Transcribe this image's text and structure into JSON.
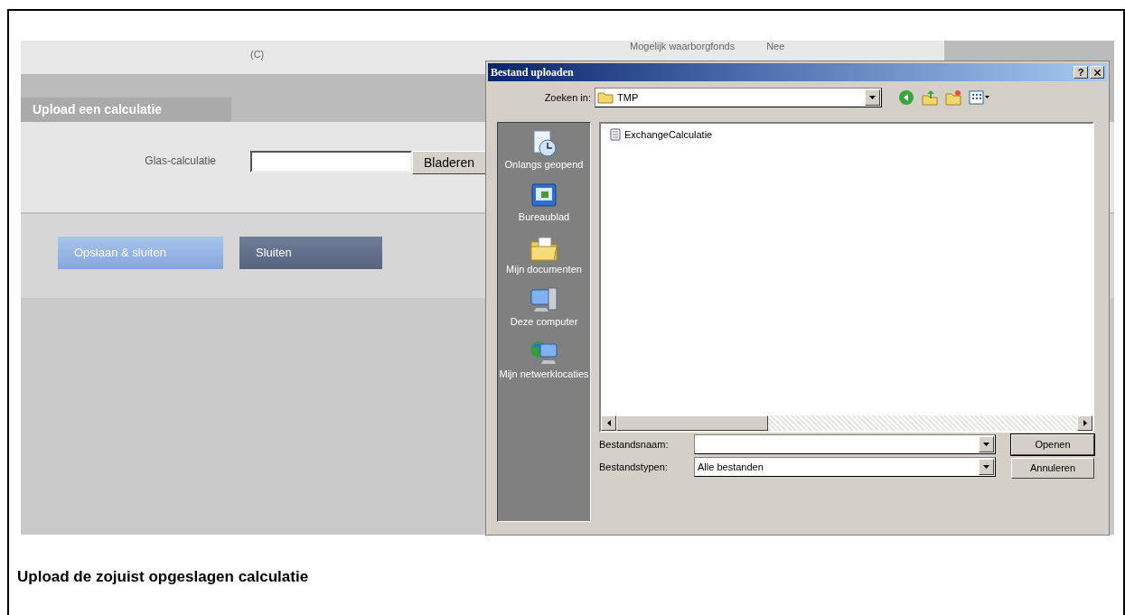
{
  "page": {
    "top_rows": [
      {
        "label": "",
        "value": "(C)"
      },
      {
        "label": "Mogelijk waarborgfonds",
        "value": "Nee"
      }
    ],
    "section_title": "Upload een calculatie",
    "field": {
      "label": "Glas-calculatie",
      "browse_button": "Bladeren"
    },
    "buttons": [
      {
        "label": "Opslaan & sluiten",
        "kind": "primary"
      },
      {
        "label": "Sluiten",
        "kind": "secondary"
      }
    ]
  },
  "dialog": {
    "title": "Bestand uploaden",
    "help_button": "?",
    "look_in": {
      "label": "Zoeken in:",
      "value": "TMP"
    },
    "places": [
      {
        "label": "Onlangs geopend",
        "kind": "recent"
      },
      {
        "label": "Bureaublad",
        "kind": "desktop"
      },
      {
        "label": "Mijn documenten",
        "kind": "documents"
      },
      {
        "label": "Deze computer",
        "kind": "computer"
      },
      {
        "label": "Mijn netwerklocaties",
        "kind": "network"
      }
    ],
    "files": [
      {
        "name": "ExchangeCalculatie"
      }
    ],
    "filename": {
      "label": "Bestandsnaam:"
    },
    "filetype": {
      "label": "Bestandstypen:",
      "value": "Alle bestanden"
    },
    "buttons": [
      "Openen",
      "Annuleren"
    ]
  },
  "caption": "Upload de zojuist opgeslagen calculatie"
}
